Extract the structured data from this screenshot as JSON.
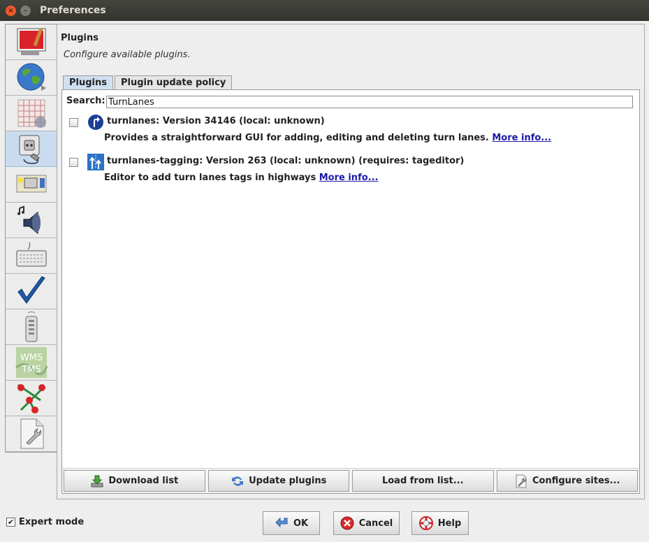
{
  "window": {
    "title": "Preferences",
    "close_glyph": "×",
    "minimize_glyph": "–"
  },
  "sidebar": {
    "items": [
      {
        "name": "display-settings",
        "icon": "paint-brush-screen-icon"
      },
      {
        "name": "map-settings",
        "icon": "globe-icon"
      },
      {
        "name": "projection-settings",
        "icon": "grid-map-icon"
      },
      {
        "name": "plugins",
        "icon": "plug-icon",
        "active": true
      },
      {
        "name": "toolbar-settings",
        "icon": "toolbar-icon"
      },
      {
        "name": "audio-settings",
        "icon": "speaker-icon"
      },
      {
        "name": "shortcuts",
        "icon": "keyboard-icon"
      },
      {
        "name": "validator",
        "icon": "checkmark-icon"
      },
      {
        "name": "remote-control",
        "icon": "remote-control-icon"
      },
      {
        "name": "imagery",
        "icon": "wms-tms-icon",
        "label_lines": [
          "WMS",
          "TMS"
        ]
      },
      {
        "name": "connection",
        "icon": "connection-icon"
      },
      {
        "name": "advanced",
        "icon": "document-wrench-icon"
      }
    ]
  },
  "main": {
    "title": "Plugins",
    "description": "Configure available plugins.",
    "tabs": [
      {
        "label": "Plugins",
        "selected": true
      },
      {
        "label": "Plugin update policy",
        "selected": false
      }
    ],
    "search": {
      "label": "Search:",
      "value": "TurnLanes"
    },
    "plugins": [
      {
        "title": "turnlanes: Version 34146 (local: unknown)",
        "description": "Provides a straightforward GUI for adding, editing and deleting turn lanes.",
        "link": "More info...",
        "checked": false,
        "icon": "turnlanes-icon"
      },
      {
        "title": "turnlanes-tagging: Version 263 (local: unknown) (requires: tageditor)",
        "description": "Editor to add turn lanes tags in highways",
        "link": "More info...",
        "checked": false,
        "icon": "turnlanes-tagging-icon"
      }
    ],
    "buttons": [
      {
        "label": "Download list",
        "icon": "download-icon"
      },
      {
        "label": "Update plugins",
        "icon": "refresh-icon"
      },
      {
        "label": "Load from list...",
        "icon": ""
      },
      {
        "label": "Configure sites...",
        "icon": "configure-icon"
      }
    ]
  },
  "footer": {
    "expert_mode_label": "Expert mode",
    "expert_mode_checked": true,
    "expert_mode_mark": "✔",
    "ok_label": "OK",
    "cancel_label": "Cancel",
    "help_label": "Help"
  },
  "colors": {
    "titlebar": "#3c3b37",
    "selected_tab": "#cfe0f1",
    "link": "#1a1aa8",
    "close_button": "#ee5a2a"
  }
}
